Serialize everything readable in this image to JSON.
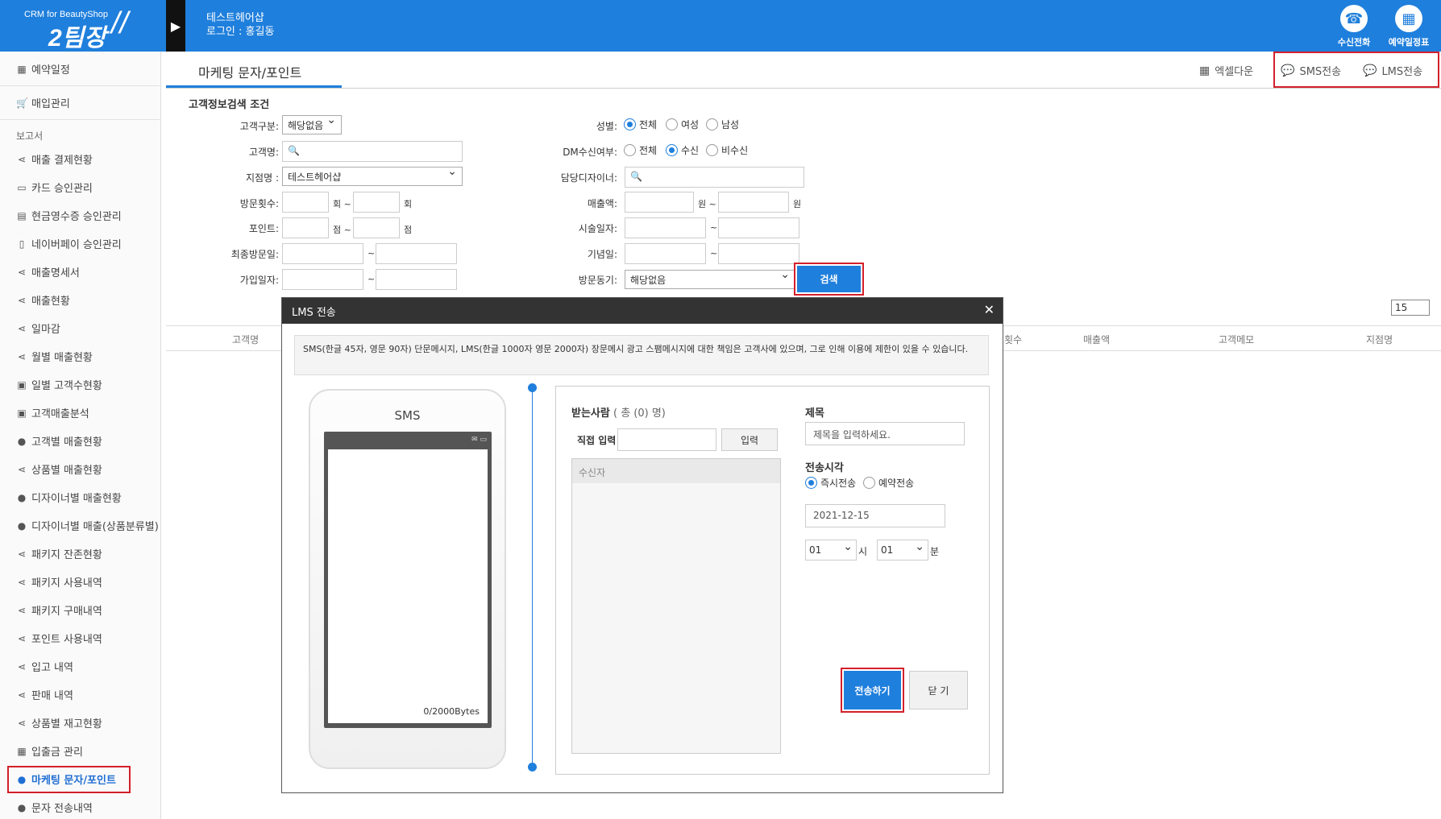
{
  "app": {
    "logo_small": "CRM for BeautyShop",
    "logo_big": "2팀장",
    "shop_name": "테스트헤어샵",
    "login": "로그인 : 홍길동"
  },
  "top_icons": [
    {
      "label": "수신전화",
      "icon": "phone-icon"
    },
    {
      "label": "예약일정표",
      "icon": "calendar-icon"
    }
  ],
  "sidebar": {
    "reservation": "예약일정",
    "purchase": "매입관리",
    "report_head": "보고서",
    "items": [
      "매출 결제현황",
      "카드 승인관리",
      "현금영수증 승인관리",
      "네이버페이 승인관리",
      "매출명세서",
      "매출현황",
      "일마감",
      "월별 매출현황",
      "일별 고객수현황",
      "고객매출분석",
      "고객별 매출현황",
      "상품별 매출현황",
      "디자이너별 매출현황",
      "디자이너별 매출(상품분류별)",
      "패키지 잔존현황",
      "패키지 사용내역",
      "패키지 구매내역",
      "포인트 사용내역",
      "입고 내역",
      "판매 내역",
      "상품별 재고현황",
      "입출금 관리",
      "마케팅 문자/포인트",
      "문자 전송내역"
    ]
  },
  "page": {
    "title": "마케팅 문자/포인트",
    "excel": "엑셀다운",
    "sms": "SMS전송",
    "lms": "LMS전송"
  },
  "search": {
    "section_title": "고객정보검색 조건",
    "customer_type_label": "고객구분:",
    "customer_type_value": "해당없음",
    "name_label": "고객명:",
    "branch_label": "지점명 :",
    "branch_value": "테스트헤어샵",
    "visits_label": "방문횟수:",
    "visits_unit1": "회 ~",
    "visits_unit2": "회",
    "points_label": "포인트:",
    "points_unit1": "점 ~",
    "points_unit2": "점",
    "last_visit_label": "최종방문일:",
    "join_label": "가입일자:",
    "tilde": "~",
    "gender_label": "성별:",
    "gender_options": [
      "전체",
      "여성",
      "남성"
    ],
    "dm_label": "DM수신여부:",
    "dm_options": [
      "전체",
      "수신",
      "비수신"
    ],
    "designer_label": "담당디자이너:",
    "sales_label": "매출액:",
    "sales_unit1": "원 ~",
    "sales_unit2": "원",
    "procedure_label": "시술일자:",
    "anniv_label": "기념일:",
    "motive_label": "방문동기:",
    "motive_value": "해당없음",
    "search_btn": "검색",
    "page_size": "15"
  },
  "table_headers": [
    "고객명",
    "횟수",
    "매출액",
    "고객메모",
    "지점명"
  ],
  "modal": {
    "title": "LMS 전송",
    "notice": "SMS(한글 45자, 영문 90자) 단문메시지, LMS(한글 1000자 영문 2000자) 장문메시 광고 스팸메시지에 대한 책임은 고객사에 있으며, 그로 인해 이용에 제한이 있을 수 있습니다.",
    "phone_label": "SMS",
    "bytes": "0/2000Bytes",
    "recv_label": "받는사람",
    "recv_count": "( 총 (0) 명)",
    "direct_label": "직접 입력",
    "input_btn": "입력",
    "list_head": "수신자",
    "subject_label": "제목",
    "subject_placeholder": "제목을 입력하세요.",
    "time_label": "전송시각",
    "time_opt1": "즉시전송",
    "time_opt2": "예약전송",
    "date": "2021-12-15",
    "hour": "01",
    "hour_unit": "시",
    "minute": "01",
    "minute_unit": "분",
    "send_btn": "전송하기",
    "close_btn": "닫 기"
  },
  "colors": {
    "primary": "#1f7fdc",
    "highlight": "#d3202b"
  }
}
